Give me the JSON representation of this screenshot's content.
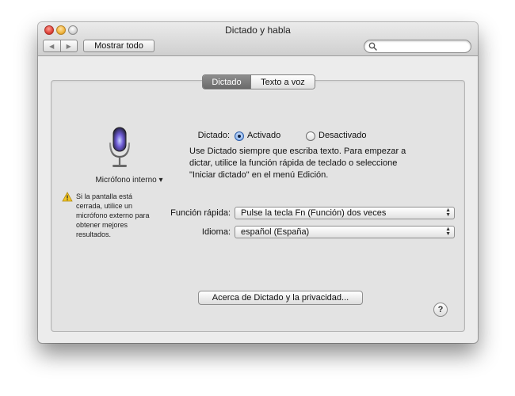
{
  "window": {
    "title": "Dictado y habla"
  },
  "toolbar": {
    "back_icon": "chevron-left-icon",
    "forward_icon": "chevron-right-icon",
    "show_all_label": "Mostrar todo",
    "search_value": "",
    "search_icon": "magnifier-icon"
  },
  "tabs": [
    {
      "label": "Dictado",
      "selected": true
    },
    {
      "label": "Texto a voz",
      "selected": false
    }
  ],
  "sidebar": {
    "mic_icon": "microphone-icon",
    "mic_label": "Micrófono interno ▾",
    "warning_icon": "warning-triangle-icon",
    "warning_text": "Si la pantalla está\ncerrada, utilice un\nmicrófono externo para\nobtener mejores\nresultados."
  },
  "dictation": {
    "label": "Dictado:",
    "on_label": "Activado",
    "off_label": "Desactivado",
    "selected": "on",
    "description": "Use Dictado siempre que escriba texto. Para empezar a\ndictar, utilice la función rápida de teclado o seleccione\n\"Iniciar dictado\" en el menú Edición."
  },
  "shortcut": {
    "label": "Función rápida:",
    "value": "Pulse la tecla Fn (Función) dos veces"
  },
  "language": {
    "label": "Idioma:",
    "value": "español (España)"
  },
  "about_button_label": "Acerca de Dictado y la privacidad...",
  "help_label": "?",
  "colors": {
    "accent": "#5d8fd8",
    "mic_glow": "#6f5cd6",
    "warning": "#f3c623"
  }
}
